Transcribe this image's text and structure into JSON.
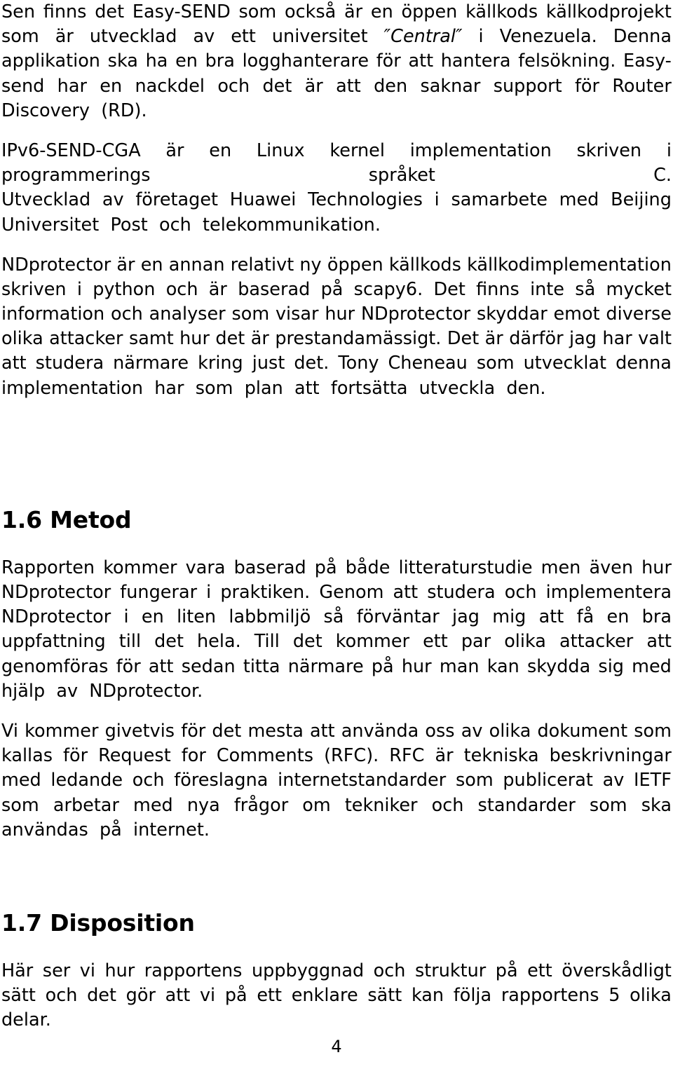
{
  "document": {
    "page_number": "4",
    "language": "sv",
    "text_color": "#000000",
    "background_color": "#ffffff"
  },
  "blocks": [
    {
      "id": "para-easysend",
      "type": "paragraph",
      "text": "Sen finns det Easy-SEND som också är en öppen källkods källkodprojekt som är utvecklad av ett universitet ″Central″ i Venezuela. Denna applikation ska ha en bra logghanterare för att hantera felsökning. Easy-send har en nackdel och det är att den saknar support för Router Discovery (RD).",
      "lines": [
        {
          "words": [
            "Sen",
            "finns",
            "det",
            "Easy-SEND",
            "som",
            "också",
            "är",
            "en",
            "öppen",
            "källkods",
            "källkodprojekt"
          ],
          "last": false
        },
        {
          "words": [
            "som",
            "är",
            "utvecklad",
            "av",
            "ett",
            "universitet",
            "″Central″",
            "i",
            "Venezuela.",
            "Denna"
          ],
          "last": false,
          "italic_words": [
            6
          ]
        },
        {
          "words": [
            "applikation",
            "ska",
            "ha",
            "en",
            "bra",
            "logghanterare",
            "för",
            "att",
            "hantera",
            "felsökning.",
            "Easy-"
          ],
          "last": false
        },
        {
          "words": [
            "send",
            "har",
            "en",
            "nackdel",
            "och",
            "det",
            "är",
            "att",
            "den",
            "saknar",
            "support",
            "för",
            "Router"
          ],
          "last": false
        },
        {
          "words": [
            "Discovery",
            "(RD)."
          ],
          "last": true
        }
      ]
    },
    {
      "id": "para-ipv6-send-cga",
      "type": "paragraph",
      "text": "IPv6-SEND-CGA är en Linux kernel implementation skriven i programmerings språket C. Utvecklad av företaget Huawei Technologies i samarbete med Beijing Universitet Post och telekommunikation.",
      "lines": [
        {
          "words": [
            "IPv6-SEND-CGA",
            "är",
            "en",
            "Linux",
            "kernel",
            "implementation",
            "skriven",
            "i"
          ],
          "last": false
        },
        {
          "words": [
            "programmerings",
            "språket",
            "C."
          ],
          "last": false
        },
        {
          "words": [
            "Utvecklad",
            "av",
            "företaget",
            "Huawei",
            "Technologies",
            "i",
            "samarbete",
            "med",
            "Beijing"
          ],
          "last": false
        },
        {
          "words": [
            "Universitet",
            "Post",
            "och",
            "telekommunikation."
          ],
          "last": true
        }
      ]
    },
    {
      "id": "para-ndprotector",
      "type": "paragraph",
      "text": "NDprotector är en annan relativt ny öppen källkods källkodimplementation skriven i python och är baserad på scapy6. Det finns inte så mycket information och analyser som visar hur NDprotector skyddar emot diverse olika attacker samt hur det är prestandamässigt. Det är därför jag har valt att studera närmare kring just det. Tony Cheneau som utvecklat denna implementation har som plan att fortsätta utveckla den.",
      "lines": [
        {
          "words": [
            "NDprotector",
            "är",
            "en",
            "annan",
            "relativt",
            "ny",
            "öppen",
            "källkods",
            "källkodimplementation"
          ],
          "last": false
        },
        {
          "words": [
            "skriven",
            "i",
            "python",
            "och",
            "är",
            "baserad",
            "på",
            "scapy6.",
            "Det",
            "finns",
            "inte",
            "så",
            "mycket"
          ],
          "last": false
        },
        {
          "words": [
            "information",
            "och",
            "analyser",
            "som",
            "visar",
            "hur",
            "NDprotector",
            "skyddar",
            "emot",
            "diverse"
          ],
          "last": false
        },
        {
          "words": [
            "olika",
            "attacker",
            "samt",
            "hur",
            "det",
            "är",
            "prestandamässigt.",
            "Det",
            "är",
            "därför",
            "jag",
            "har",
            "valt"
          ],
          "last": false
        },
        {
          "words": [
            "att",
            "studera",
            "närmare",
            "kring",
            "just",
            "det.",
            "Tony",
            "Cheneau",
            "som",
            "utvecklat",
            "denna"
          ],
          "last": false
        },
        {
          "words": [
            "implementation",
            "har",
            "som",
            "plan",
            "att",
            "fortsätta",
            "utveckla",
            "den."
          ],
          "last": true
        }
      ]
    },
    {
      "id": "heading-metod",
      "type": "heading",
      "text": "1.6 Metod"
    },
    {
      "id": "para-metod-1",
      "type": "paragraph",
      "text": "Rapporten kommer vara baserad på både litteraturstudie men även hur NDprotector fungerar i praktiken. Genom att studera och implementera NDprotector i en liten labbmiljö så förväntar jag mig att få en bra uppfattning till det hela. Till det kommer ett par olika attacker att genomföras för att sedan titta närmare på hur man kan skydda sig med hjälp av NDprotector.",
      "lines": [
        {
          "words": [
            "Rapporten",
            "kommer",
            "vara",
            "baserad",
            "på",
            "både",
            "litteraturstudie",
            "men",
            "även",
            "hur"
          ],
          "last": false
        },
        {
          "words": [
            "NDprotector",
            "fungerar",
            "i",
            "praktiken.",
            "Genom",
            "att",
            "studera",
            "och",
            "implementera"
          ],
          "last": false
        },
        {
          "words": [
            "NDprotector",
            "i",
            "en",
            "liten",
            "labbmiljö",
            "så",
            "förväntar",
            "jag",
            "mig",
            "att",
            "få",
            "en",
            "bra"
          ],
          "last": false
        },
        {
          "words": [
            "uppfattning",
            "till",
            "det",
            "hela.",
            "Till",
            "det",
            "kommer",
            "ett",
            "par",
            "olika",
            "attacker",
            "att"
          ],
          "last": false
        },
        {
          "words": [
            "genomföras",
            "för",
            "att",
            "sedan",
            "titta",
            "närmare",
            "på",
            "hur",
            "man",
            "kan",
            "skydda",
            "sig",
            "med"
          ],
          "last": false
        },
        {
          "words": [
            "hjälp",
            "av",
            "NDprotector."
          ],
          "last": true
        }
      ]
    },
    {
      "id": "para-metod-2",
      "type": "paragraph",
      "text": "Vi kommer givetvis för det mesta att använda oss av olika dokument som kallas för Request for Comments (RFC). RFC är tekniska beskrivningar med ledande och föreslagna internetstandarder som publicerat av IETF som arbetar med nya frågor om tekniker och standarder som ska användas på internet.",
      "lines": [
        {
          "words": [
            "Vi",
            "kommer",
            "givetvis",
            "för",
            "det",
            "mesta",
            "att",
            "använda",
            "oss",
            "av",
            "olika",
            "dokument",
            "som"
          ],
          "last": false
        },
        {
          "words": [
            "kallas",
            "för",
            "Request",
            "for",
            "Comments",
            "(RFC).",
            "RFC",
            "är",
            "tekniska",
            "beskrivningar"
          ],
          "last": false
        },
        {
          "words": [
            "med",
            "ledande",
            "och",
            "föreslagna",
            "internetstandarder",
            "som",
            "publicerat",
            "av",
            "IETF"
          ],
          "last": false
        },
        {
          "words": [
            "som",
            "arbetar",
            "med",
            "nya",
            "frågor",
            "om",
            "tekniker",
            "och",
            "standarder",
            "som",
            "ska"
          ],
          "last": false
        },
        {
          "words": [
            "användas",
            "på",
            "internet."
          ],
          "last": true
        }
      ]
    },
    {
      "id": "heading-disposition",
      "type": "heading",
      "text": "1.7 Disposition"
    },
    {
      "id": "para-disposition",
      "type": "paragraph",
      "text": "Här ser vi hur rapportens uppbyggnad och struktur på ett överskådligt sätt och det gör att vi på ett enklare sätt kan följa rapportens 5 olika delar.",
      "lines": [
        {
          "words": [
            "Här",
            "ser",
            "vi",
            "hur",
            "rapportens",
            "uppbyggnad",
            "och",
            "struktur",
            "på",
            "ett",
            "överskådligt"
          ],
          "last": false
        },
        {
          "words": [
            "sätt",
            "och",
            "det",
            "gör",
            "att",
            "vi",
            "på",
            "ett",
            "enklare",
            "sätt",
            "kan",
            "följa",
            "rapportens",
            "5",
            "olika"
          ],
          "last": false
        },
        {
          "words": [
            "delar."
          ],
          "last": true
        }
      ]
    }
  ]
}
